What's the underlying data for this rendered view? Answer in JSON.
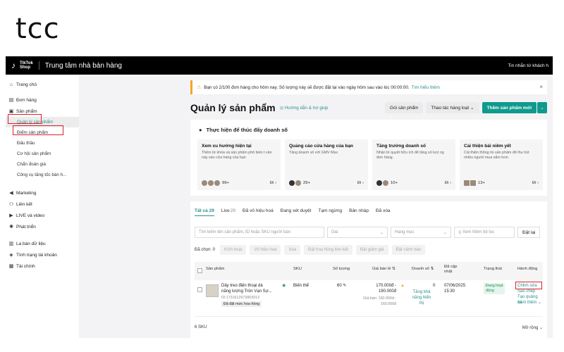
{
  "brand": "tcc",
  "topbar": {
    "logo_mark": "♪",
    "logo_line1": "TikTok",
    "logo_line2": "Shop",
    "title": "Trung tâm nhà bán hàng",
    "right_link": "Tin nhắn từ khách h"
  },
  "sidebar": {
    "home": "Trang chủ",
    "orders": "Đơn hàng",
    "products": "Sản phẩm",
    "product_sub": [
      "Quản lý sản phẩm",
      "Điểm sản phẩm",
      "Đấu thầu",
      "Cơ hội sản phẩm",
      "Chẩn đoán giá",
      "Công cụ tăng tốc bán h..."
    ],
    "marketing": "Marketing",
    "affiliate": "Liên kết",
    "live": "LIVE và video",
    "growth": "Phát triển",
    "compass": "La bàn dữ liệu",
    "account_health": "Tình trạng tài khoản",
    "finance": "Tài chính"
  },
  "notice": {
    "text": "Bạn có 2/100 đơn hàng cho hôm nay. Số lượng này sẽ được đặt lại vào ngày hôm sau vào lúc 00:00:00.",
    "link": "Tìm hiểu thêm"
  },
  "header": {
    "title": "Quản lý sản phẩm",
    "guide": "Hướng dẫn & trợ giúp",
    "btn_package": "Gói sản phẩm",
    "btn_bulk": "Thao tác hàng loạt",
    "btn_add": "Thêm sản phẩm mới"
  },
  "suggest": {
    "title": "Thực hiện để thúc đẩy doanh số",
    "go": "Đi",
    "tiles": [
      {
        "title": "Xem xu hướng hiện tại",
        "desc": "Thêm từ khóa và sản phẩm phổ biến t vấn này vào cửa hàng của bạn",
        "count": "99+"
      },
      {
        "title": "Quảng cáo cửa hàng của bạn",
        "desc": "Tăng doanh số với GMV Max",
        "count": "29+"
      },
      {
        "title": "Tăng trưởng doanh số",
        "desc": "Nhận bí quyết hữu ích để tăng số lượ ng đơn hàng.",
        "count": "10+"
      },
      {
        "title": "Cải thiện bài niêm yết",
        "desc": "Cải thiện thông tin sản phẩm để thu hút nhiều người mua sắm hơn.",
        "count": "13+"
      }
    ]
  },
  "tabs": {
    "all": "Tất cả",
    "all_count": "29",
    "live": "Live",
    "live_count": "29",
    "deactivated": "Đã vô hiệu hoá",
    "reviewing": "Đang xét duyệt",
    "paused": "Tạm ngừng",
    "draft": "Bản nháp",
    "deleted": "Đã xóa"
  },
  "filters": {
    "search_placeholder": "Tìm kiếm tên sản phẩm, ID hoặc SKU người bán",
    "price": "Giá",
    "category": "Hạng mục",
    "more": "Xem thêm bộ lọc",
    "reset": "Đặt lại"
  },
  "bulk": {
    "label": "Đã chọn: 0",
    "buttons": [
      "Kích hoạt",
      "Vô hiệu hoá",
      "Xóa",
      "Đặt hoa hồng liên kết",
      "Đặt giảm giá",
      "Đặt cảnh báo"
    ]
  },
  "table": {
    "col_product": "Sản phẩm",
    "col_sku": "SKU",
    "col_qty": "Số lượng",
    "col_price": "Giá bán lẻ",
    "col_sales": "Doanh số",
    "col_updated_1": "Đã cập",
    "col_updated_2": "nhật",
    "col_status": "Trạng thái",
    "col_action": "Hành động",
    "row": {
      "name_1": "Dây treo điện thoại dá",
      "name_2": "năng lượng Tròn Vạn Sự...",
      "id": "ID:1731612973803013",
      "tag": "Đã đặt mức hoa hồng",
      "sku": "Biến thể",
      "qty": "60",
      "price_1": "170.000đ -",
      "price_2": "190.000đ",
      "price_note_1": "Giá bán: 150.000đ -",
      "price_note_2": "160.000đ",
      "sales": "0",
      "sales_hint_1": "Tăng khả",
      "sales_hint_2": "năng hiển",
      "sales_hint_3": "thị",
      "date": "07/06/2025",
      "time": "15:30",
      "status_1": "Đang hoạt",
      "status_2": "động",
      "action_edit": "Chỉnh sửa",
      "action_copy": "Sao chép",
      "action_promo": "Tạo quảng cá",
      "action_more": "Xem thêm"
    }
  },
  "footer": {
    "count": "6 SKU",
    "expand": "Mở rộng"
  },
  "colors": {
    "accent": "#2b8f8a",
    "primary_button": "#0f9a8d",
    "highlight_box": "#e01f2d",
    "warning": "#f5a623"
  }
}
